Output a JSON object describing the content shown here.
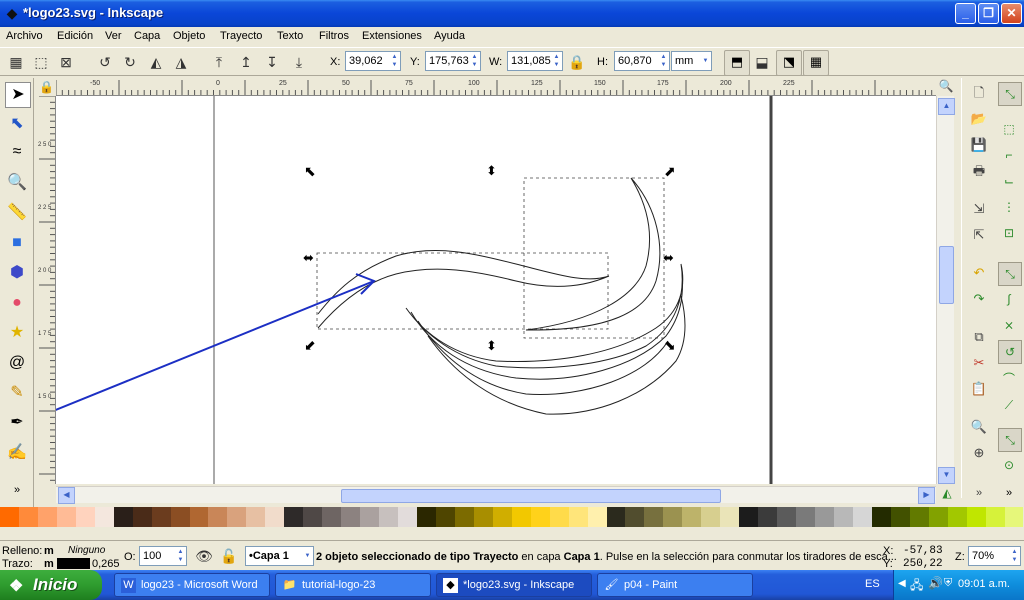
{
  "window": {
    "title": "*logo23.svg - Inkscape",
    "buttons": {
      "minimize": "_",
      "maximize": "❐",
      "close": "✕"
    }
  },
  "menu": [
    "Archivo",
    "Edición",
    "Ver",
    "Capa",
    "Objeto",
    "Trayecto",
    "Texto",
    "Filtros",
    "Extensiones",
    "Ayuda"
  ],
  "controls": {
    "x_label": "X:",
    "x_value": "39,062",
    "y_label": "Y:",
    "y_value": "175,763",
    "w_label": "W:",
    "w_value": "131,085",
    "h_label": "H:",
    "h_value": "60,870",
    "unit": "mm"
  },
  "ruler_top_labels": [
    "-50",
    "0",
    "25",
    "50",
    "75",
    "100",
    "125",
    "150",
    "175",
    "200",
    "225"
  ],
  "ruler_left_labels": [
    "2 5 0",
    "2 2 5",
    "2 0 0",
    "1 7 5",
    "1 5 0"
  ],
  "palette_colors": [
    "#ff6a00",
    "#ff8a3a",
    "#ffa26a",
    "#ffbb96",
    "#ffd3be",
    "#f4e7de",
    "#2a1f19",
    "#4a2b18",
    "#6b3c1e",
    "#8b4e23",
    "#b06731",
    "#c98658",
    "#d9a27d",
    "#e7c0a3",
    "#f1dccb",
    "#2e2a29",
    "#4f4846",
    "#6e6563",
    "#8c8280",
    "#aaa19f",
    "#c7c0be",
    "#e2dcdb",
    "#2b2700",
    "#4f4500",
    "#7c6b00",
    "#a88e00",
    "#d0ae00",
    "#f2c800",
    "#ffd21a",
    "#ffdb4a",
    "#ffe57a",
    "#fff0ad",
    "#2b2a1d",
    "#514d2e",
    "#77703e",
    "#9b9250",
    "#bdb36a",
    "#d7cf8f",
    "#eae4b8",
    "#1c1c1c",
    "#3b3b3b",
    "#5b5b5b",
    "#7a7a7a",
    "#999999",
    "#b8b8b8",
    "#d6d6d6",
    "#232b00",
    "#425100",
    "#627a00",
    "#82a200",
    "#a2c800",
    "#c0e600",
    "#d6f23a",
    "#e6f77a"
  ],
  "status": {
    "fill_label": "Relleno:",
    "fill_m": "m",
    "fill_value": "Ninguno",
    "stroke_label": "Trazo:",
    "stroke_m": "m",
    "stroke_width": "0,265",
    "opacity_label": "O:",
    "opacity_value": "100",
    "layer": "•Capa 1",
    "msg_count": "2 objeto seleccionado de tipo",
    "msg_type": "Trayecto",
    "msg_in": "en capa",
    "msg_layer": "Capa 1",
    "msg_rest": ". Pulse en la selección para conmutar los tiradores de esca...",
    "cursor_x_label": "X:",
    "cursor_x": "-57,83",
    "cursor_y_label": "Y:",
    "cursor_y": "250,22",
    "zoom_label": "Z:",
    "zoom_value": "70%"
  },
  "taskbar": {
    "start": "Inicio",
    "tasks": [
      {
        "label": "logo23 - Microsoft Word",
        "icon": "W"
      },
      {
        "label": "tutorial-logo-23",
        "icon": "📁"
      },
      {
        "label": "*logo23.svg - Inkscape",
        "icon": "◆"
      },
      {
        "label": "p04 - Paint",
        "icon": "🖌"
      }
    ],
    "language": "ES",
    "clock": "09:01 a.m."
  },
  "colors": {
    "accent_arrow": "#1c2fc4",
    "title_bar": "#0a46d8",
    "start_green": "#2f9c2f"
  }
}
